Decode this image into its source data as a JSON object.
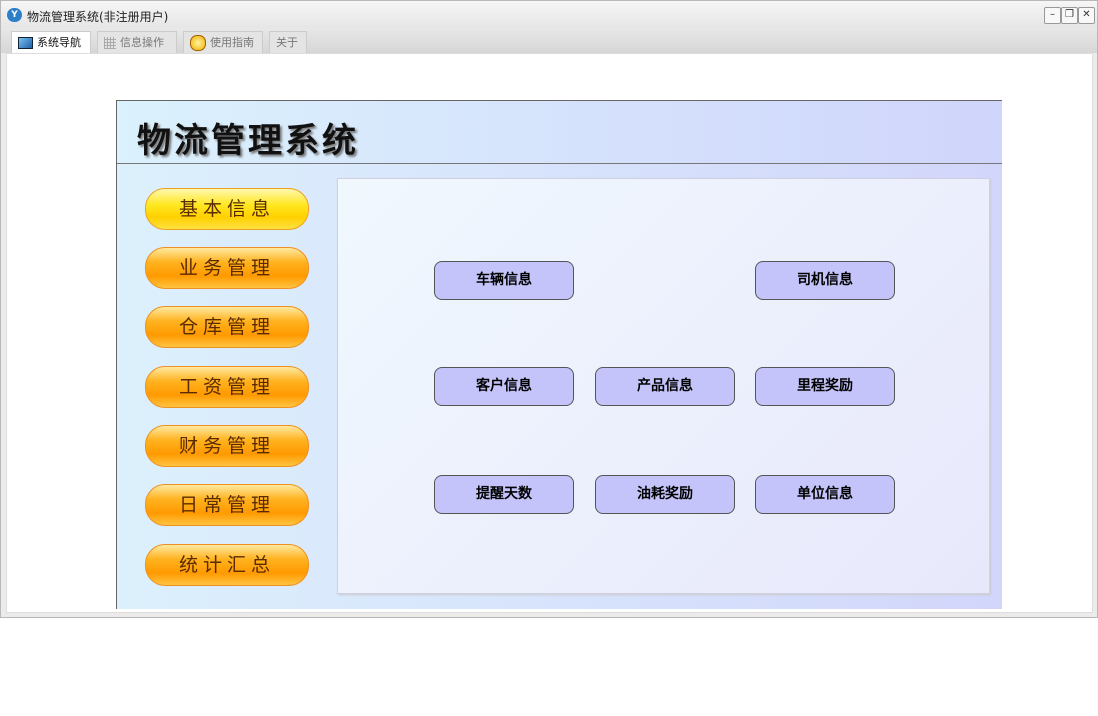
{
  "window": {
    "title": "物流管理系统(非注册用户)",
    "controls": {
      "minimize": "–",
      "restore": "❐",
      "close": "✕"
    }
  },
  "tabs": [
    {
      "label": "系统导航",
      "icon": "monitor-icon"
    },
    {
      "label": "信息操作",
      "icon": "grid-icon"
    },
    {
      "label": "使用指南",
      "icon": "help-icon"
    },
    {
      "label": "关于"
    }
  ],
  "header": {
    "title": "物流管理系统"
  },
  "sidebar": {
    "items": [
      "基本信息",
      "业务管理",
      "仓库管理",
      "工资管理",
      "财务管理",
      "日常管理",
      "统计汇总"
    ]
  },
  "functions": [
    "车辆信息",
    "司机信息",
    "客户信息",
    "产品信息",
    "里程奖励",
    "提醒天数",
    "油耗奖励",
    "单位信息"
  ],
  "colors": {
    "function_button": "#c4c4fa",
    "side_button": "#ff9a00",
    "side_button_active": "#ffe820"
  }
}
